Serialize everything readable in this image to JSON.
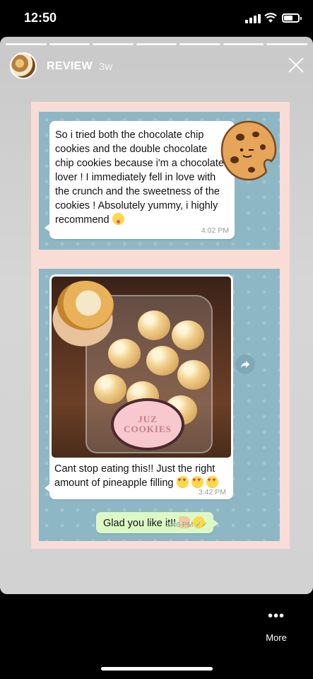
{
  "status_bar": {
    "time": "12:50"
  },
  "story": {
    "username": "REVIEW",
    "age": "3w",
    "segments": 7
  },
  "chat": {
    "message_1": {
      "text": "So i tried both the chocolate chip cookies and the double chocolate chip cookies because i'm a chocolate lover ! I immediately fell in love with the crunch and the sweetness of the cookies ! Absolutely yummy, i highly recommend",
      "emoji": "tongue-face-emoji",
      "time": "4:02 PM"
    },
    "message_2": {
      "photo_label_line1": "JUZ",
      "photo_label_line2": "COOKIES",
      "text": "Cant stop eating this!! Just the right amount of pineapple filling",
      "emoji": "heart-eyes-emoji",
      "time": "3:42 PM"
    },
    "reply": {
      "text": "Glad you like it!!",
      "emoji": "thumbs-up-emoji",
      "time": "3:46 PM",
      "ticks": "✓✓"
    }
  },
  "footer": {
    "more_label": "More"
  },
  "colors": {
    "panel": "#8db7c5",
    "frame": "#f9dcd6",
    "reply_bubble": "#dcf8c6"
  }
}
